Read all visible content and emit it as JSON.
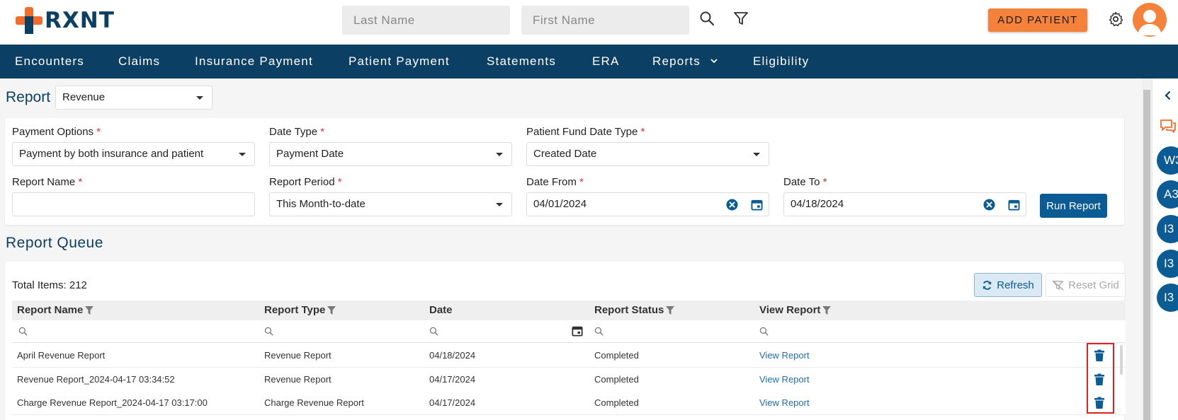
{
  "brand": {
    "logo_text": "RXNT",
    "accent": "#f26d2b",
    "primary": "#0b3f63"
  },
  "header": {
    "last_name_placeholder": "Last Name",
    "first_name_placeholder": "First Name",
    "search_icon": "search-icon",
    "filter_icon": "filter-icon",
    "add_patient_label": "ADD PATIENT",
    "settings_icon": "gear-icon",
    "avatar_icon": "user-avatar"
  },
  "nav": {
    "items": [
      "Encounters",
      "Claims",
      "Insurance Payment",
      "Patient Payment",
      "Statements",
      "ERA",
      "Reports",
      "Eligibility"
    ]
  },
  "report": {
    "label": "Report",
    "selected": "Revenue"
  },
  "form": {
    "payment_options": {
      "label": "Payment Options",
      "value": "Payment by both insurance and patient"
    },
    "date_type": {
      "label": "Date Type",
      "value": "Payment Date"
    },
    "patient_fund_date_type": {
      "label": "Patient Fund Date Type",
      "value": "Created Date"
    },
    "report_name": {
      "label": "Report Name",
      "value": ""
    },
    "report_period": {
      "label": "Report Period",
      "value": "This Month-to-date"
    },
    "date_from": {
      "label": "Date From",
      "value": "04/01/2024"
    },
    "date_to": {
      "label": "Date To",
      "value": "04/18/2024"
    },
    "required_mark": "*",
    "run_report_label": "Run Report"
  },
  "queue": {
    "title": "Report Queue",
    "total_items": "Total Items: 212",
    "refresh_label": "Refresh",
    "reset_grid_label": "Reset Grid",
    "columns": [
      "Report Name",
      "Report Type",
      "Date",
      "Report Status",
      "View Report"
    ],
    "rows": [
      {
        "name": "April Revenue Report",
        "type": "Revenue Report",
        "date": "04/18/2024",
        "status": "Completed",
        "view": "View Report"
      },
      {
        "name": "Revenue Report_2024-04-17 03:34:52",
        "type": "Revenue Report",
        "date": "04/17/2024",
        "status": "Completed",
        "view": "View Report"
      },
      {
        "name": "Charge Revenue Report_2024-04-17 03:17:00",
        "type": "Charge Revenue Report",
        "date": "04/17/2024",
        "status": "Completed",
        "view": "View Report"
      }
    ]
  },
  "side_panel": {
    "chat_icon": "chat-icon",
    "collapse_icon": "chevron-left-icon",
    "circles": [
      "W3",
      "A3",
      "I3",
      "I3",
      "I3"
    ]
  }
}
